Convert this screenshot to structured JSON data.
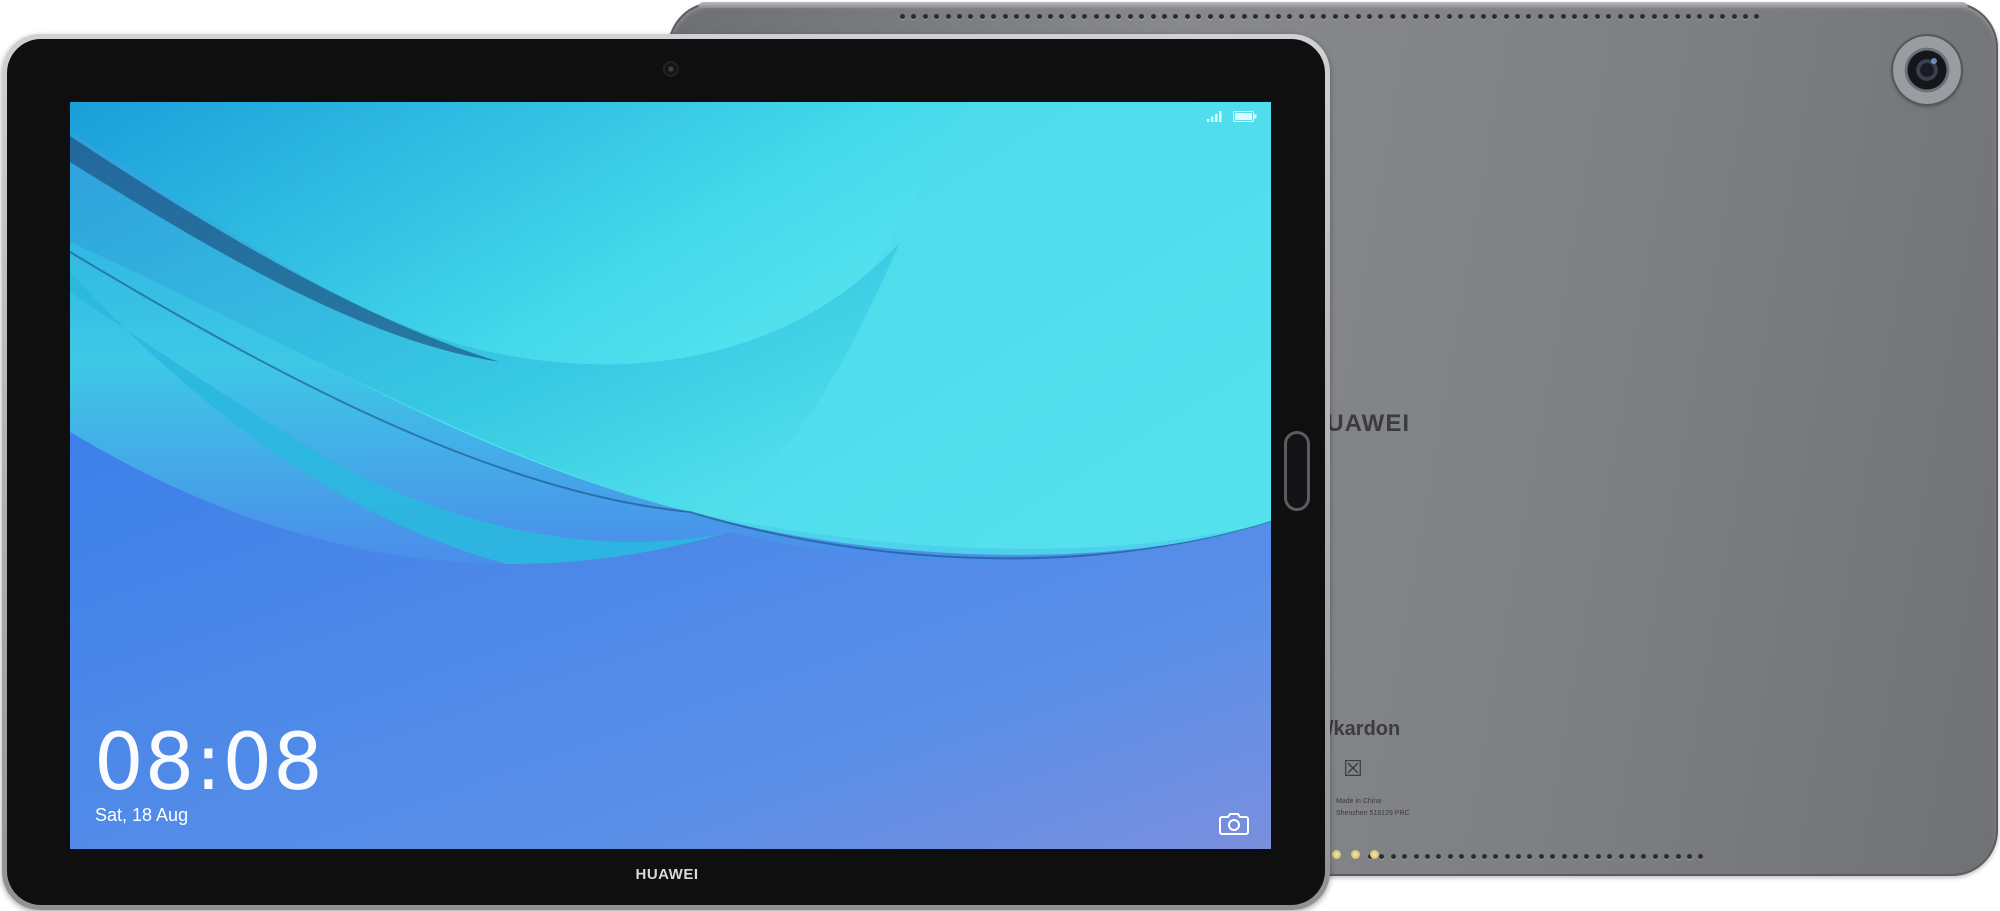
{
  "device": {
    "brand_front": "HUAWEI",
    "brand_back": "HUAWEI",
    "back_audio_mark": "/kardon",
    "back_fine_print": [
      "Made in China",
      "Shenzhen 518129 PRC"
    ]
  },
  "lockscreen": {
    "time": "08:08",
    "date": "Sat, 18 Aug",
    "icons": [
      "signal-icon",
      "battery-icon",
      "camera-icon"
    ]
  },
  "colors": {
    "wallpaper_top": "#1fa3e0",
    "wallpaper_teal": "#5ee8ef",
    "wallpaper_bottom": "#3e6fe6",
    "back_shell": "#7d7f83"
  }
}
